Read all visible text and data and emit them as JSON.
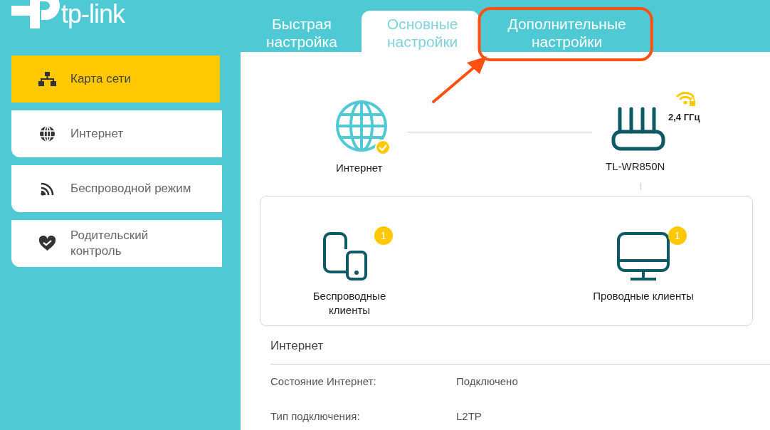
{
  "logo": {
    "text": "tp-link"
  },
  "tabs": [
    {
      "label": "Быстрая настройка",
      "selected": false,
      "highlighted": false
    },
    {
      "label": "Основные настройки",
      "selected": true,
      "highlighted": false
    },
    {
      "label": "Дополнительные настройки",
      "selected": false,
      "highlighted": true
    }
  ],
  "annotation_arrow": true,
  "sidebar": {
    "items": [
      {
        "kind": "network",
        "label": "Карта сети",
        "selected": true
      },
      {
        "kind": "globe",
        "label": "Интернет",
        "selected": false
      },
      {
        "kind": "wireless",
        "label": "Беспроводной режим",
        "selected": false
      },
      {
        "kind": "parental",
        "label": "Родительский контроль",
        "selected": false
      }
    ]
  },
  "network_map": {
    "internet": {
      "label": "Интернет",
      "connected": true
    },
    "router": {
      "model": "TL-WR850N",
      "band": "2,4 ГГц"
    },
    "clients": [
      {
        "kind": "wireless",
        "label": "Беспроводные клиенты",
        "count": "1"
      },
      {
        "kind": "wired",
        "label": "Проводные клиенты",
        "count": "1"
      }
    ]
  },
  "internet_section": {
    "title": "Интернет",
    "rows": [
      {
        "label": "Состояние Интернет:",
        "value": "Подключено"
      },
      {
        "label": "Тип подключения:",
        "value": "L2TP"
      }
    ]
  }
}
